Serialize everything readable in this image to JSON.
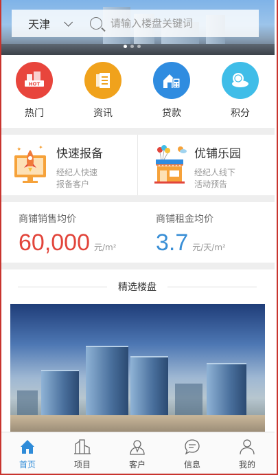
{
  "search": {
    "city": "天津",
    "placeholder": "请输入楼盘关键词"
  },
  "quick_nav": [
    {
      "label": "热门",
      "icon": "hot-icon",
      "color": "#e8453c"
    },
    {
      "label": "资讯",
      "icon": "news-icon",
      "color": "#f0a21c"
    },
    {
      "label": "贷款",
      "icon": "loan-icon",
      "color": "#2f8ce0"
    },
    {
      "label": "积分",
      "icon": "points-icon",
      "color": "#3fbde8"
    }
  ],
  "features": [
    {
      "title": "快速报备",
      "subtitle1": "经纪人快速",
      "subtitle2": "报备客户",
      "icon": "rocket-icon"
    },
    {
      "title": "优铺乐园",
      "subtitle1": "经纪人线下",
      "subtitle2": "活动预告",
      "icon": "shop-icon"
    }
  ],
  "prices": {
    "sale": {
      "label": "商铺销售均价",
      "value": "60,000",
      "unit": "元/m²",
      "color": "#e2453b"
    },
    "rent": {
      "label": "商铺租金均价",
      "value": "3.7",
      "unit": "元/天/m²",
      "color": "#3a8fd6"
    }
  },
  "featured": {
    "title": "精选楼盘"
  },
  "tabbar": [
    {
      "label": "首页",
      "icon": "home-icon",
      "active": true
    },
    {
      "label": "项目",
      "icon": "buildings-icon",
      "active": false
    },
    {
      "label": "客户",
      "icon": "customer-icon",
      "active": false
    },
    {
      "label": "信息",
      "icon": "message-icon",
      "active": false
    },
    {
      "label": "我的",
      "icon": "profile-icon",
      "active": false
    }
  ],
  "colors": {
    "accent": "#2e8bd8"
  }
}
